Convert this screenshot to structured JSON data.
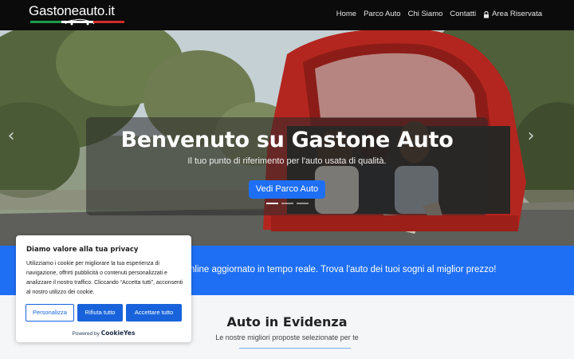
{
  "brand": {
    "logo_text": "Gastoneauto.it",
    "flag_colors": [
      "#1e9a4a",
      "#ffffff",
      "#d52b2b"
    ]
  },
  "nav": {
    "items": [
      "Home",
      "Parco Auto",
      "Chi Siamo",
      "Contatti"
    ],
    "reserved": "Area Riservata",
    "reserved_icon": "lock-icon"
  },
  "hero": {
    "title": "Benvenuto su Gastone Auto",
    "subtitle": "Il tuo punto di riferimento per l'auto usata di qualità.",
    "cta": "Vedi Parco Auto",
    "prev_icon": "chevron-left-icon",
    "next_icon": "chevron-right-icon",
    "slides_total": 3,
    "active_slide": 1
  },
  "band": {
    "text": "nline aggiornato in tempo reale. Trova l'auto dei tuoi sogni al miglior prezzo!"
  },
  "featured": {
    "title": "Auto in Evidenza",
    "subtitle": "Le nostre migliori proposte selezionate per te"
  },
  "cookie": {
    "title": "Diamo valore alla tua privacy",
    "text": "Utilizziamo i cookie per migliorare la tua esperienza di navigazione, offrirti pubblicità o contenuti personalizzati e analizzare il nostro traffico. Cliccando “Accetta tutti”, acconsenti al nostro utilizzo dei cookie.",
    "customize": "Personalizza",
    "reject": "Rifiuta tutto",
    "accept": "Accettare tutto",
    "powered_by": "Powered by",
    "powered_brand": "CookieYes"
  },
  "colors": {
    "primary": "#1f6ff5",
    "navbar": "#0b0b0b",
    "cookie_primary": "#1863dc"
  }
}
